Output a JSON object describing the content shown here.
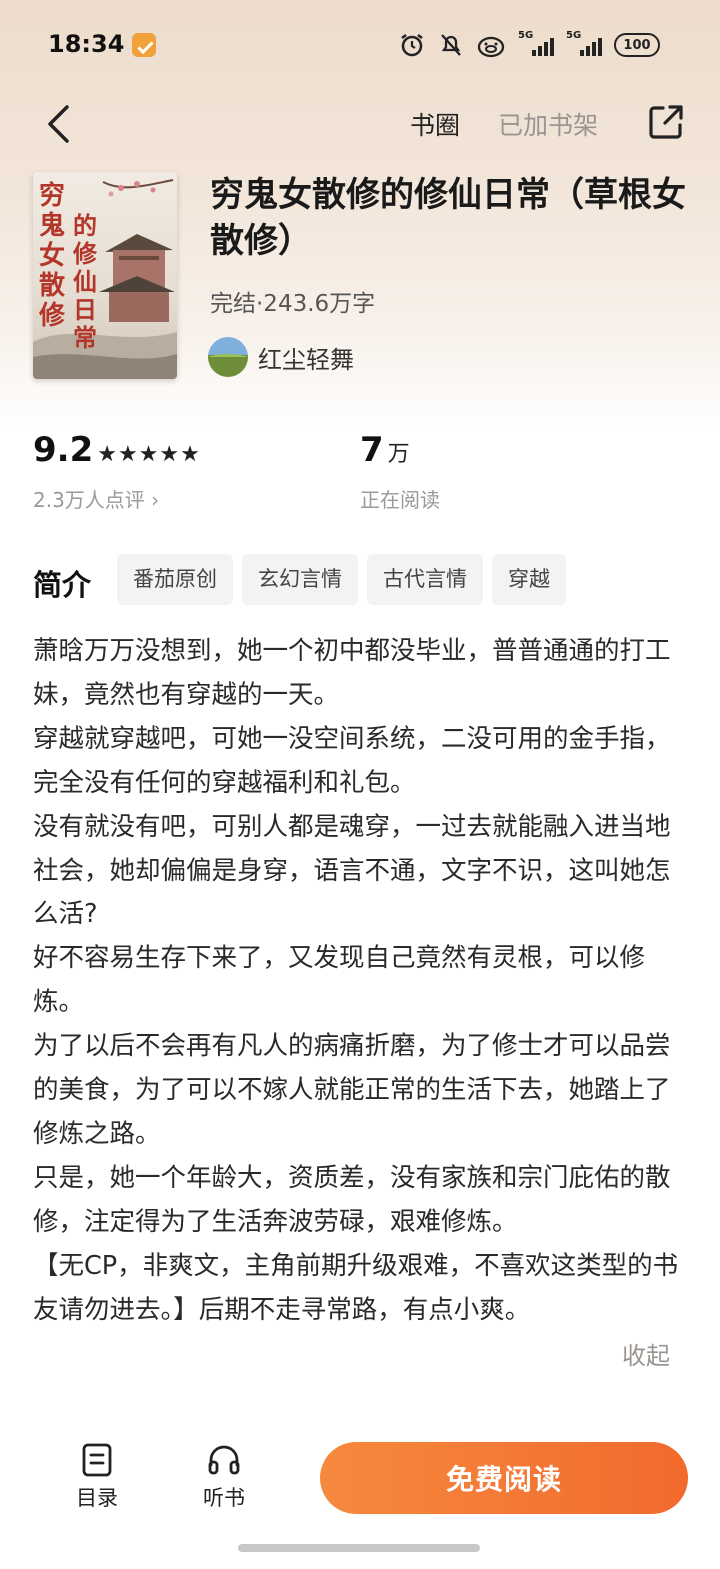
{
  "status_bar": {
    "time": "18:34",
    "network_1": "5G",
    "network_1_sub": "R",
    "network_2": "5G",
    "battery": "100"
  },
  "nav": {
    "circle_label": "书圈",
    "shelf_label": "已加书架"
  },
  "book": {
    "title": "穷鬼女散修的修仙日常（草根女散修）",
    "meta": "完结·243.6万字",
    "author": "红尘轻舞",
    "cover_title_col1": "穷鬼女散修",
    "cover_title_col2": "的修仙日常"
  },
  "stats": {
    "score": "9.2",
    "stars": "★★★★★",
    "reviews": "2.3万人点评 ›",
    "readers_num": "7",
    "readers_unit": "万",
    "readers_label": "正在阅读"
  },
  "intro": {
    "label": "简介",
    "tags": [
      "番茄原创",
      "玄幻言情",
      "古代言情",
      "穿越"
    ],
    "paragraphs": [
      "萧晗万万没想到，她一个初中都没毕业，普普通通的打工妹，竟然也有穿越的一天。",
      "穿越就穿越吧，可她一没空间系统，二没可用的金手指，完全没有任何的穿越福利和礼包。",
      "没有就没有吧，可别人都是魂穿，一过去就能融入进当地社会，她却偏偏是身穿，语言不通，文字不识，这叫她怎么活?",
      "好不容易生存下来了，又发现自己竟然有灵根，可以修炼。",
      "为了以后不会再有凡人的病痛折磨，为了修士才可以品尝的美食，为了可以不嫁人就能正常的生活下去，她踏上了修炼之路。",
      "只是，她一个年龄大，资质差，没有家族和宗门庇佑的散修，注定得为了生活奔波劳碌，艰难修炼。",
      "【无CP，非爽文，主角前期升级艰难，不喜欢这类型的书友请勿进去。】后期不走寻常路，有点小爽。"
    ],
    "collapse": "收起"
  },
  "bottom": {
    "toc": "目录",
    "listen": "听书",
    "read": "免费阅读"
  },
  "colors": {
    "accent": "#f26a2c",
    "cover_title": "#b4352a"
  }
}
